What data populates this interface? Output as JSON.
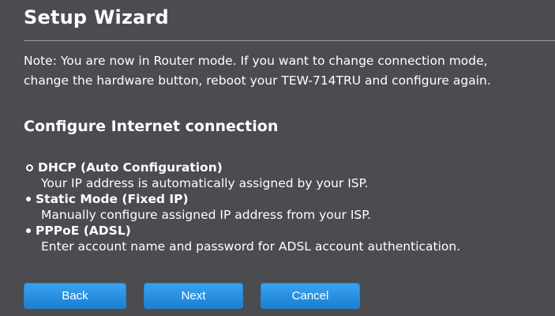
{
  "wizard": {
    "title": "Setup Wizard",
    "note_line1": "Note: You are now in Router mode. If you want to change connection mode,",
    "note_line2": "change the hardware button, reboot your TEW-714TRU and configure again.",
    "section_title": "Configure Internet connection",
    "options": [
      {
        "label": "DHCP (Auto Configuration)",
        "description": "Your IP address is automatically assigned by your ISP.",
        "selected": true
      },
      {
        "label": "Static Mode (Fixed IP)",
        "description": "Manually configure assigned IP address from your ISP.",
        "selected": false
      },
      {
        "label": "PPPoE (ADSL)",
        "description": "Enter account name and password for ADSL account authentication.",
        "selected": false
      }
    ],
    "buttons": {
      "back": "Back",
      "next": "Next",
      "cancel": "Cancel"
    }
  },
  "colors": {
    "background": "#4a4c50",
    "button": "#1f8ae0",
    "text": "#ffffff"
  }
}
